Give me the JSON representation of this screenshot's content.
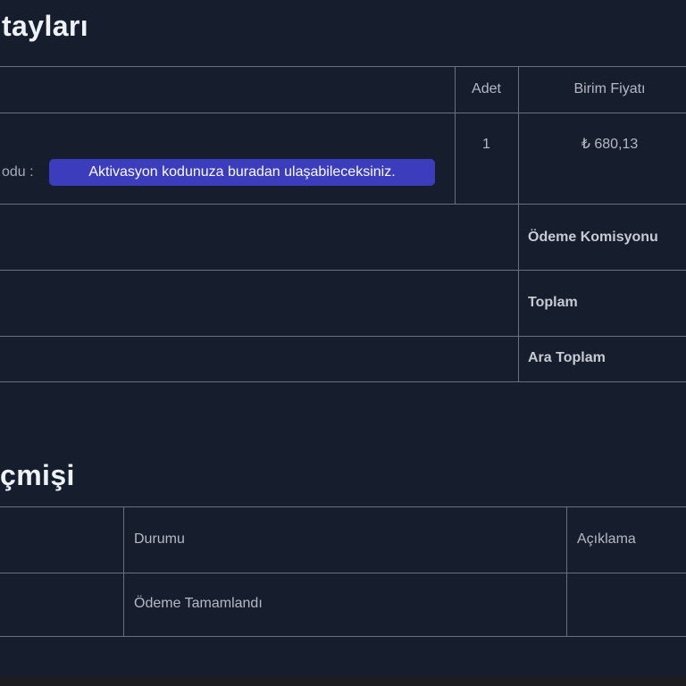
{
  "order_details": {
    "title_fragment": "tayları",
    "table": {
      "headers": {
        "quantity": "Adet",
        "unit_price": "Birim Fiyatı"
      },
      "item": {
        "quantity": "1",
        "unit_price": "₺ 680,13",
        "activation_label_fragment": "odu :",
        "activation_link_text": "Aktivasyon kodunuza buradan ulaşabileceksiniz."
      },
      "summary_rows": [
        {
          "label": "Ödeme Komisyonu"
        },
        {
          "label": "Toplam"
        },
        {
          "label": "Ara Toplam"
        }
      ]
    }
  },
  "payment_history": {
    "title_fragment": "çmişi",
    "table": {
      "headers": {
        "status": "Durumu",
        "description": "Açıklama"
      },
      "rows": [
        {
          "status": "Ödeme Tamamlandı",
          "description": ""
        }
      ]
    }
  },
  "colors": {
    "background": "#161d2d",
    "accent_link_pill": "#3c3dbd",
    "table_border": "#69707f",
    "bottom_strip": "#1d1d21"
  }
}
